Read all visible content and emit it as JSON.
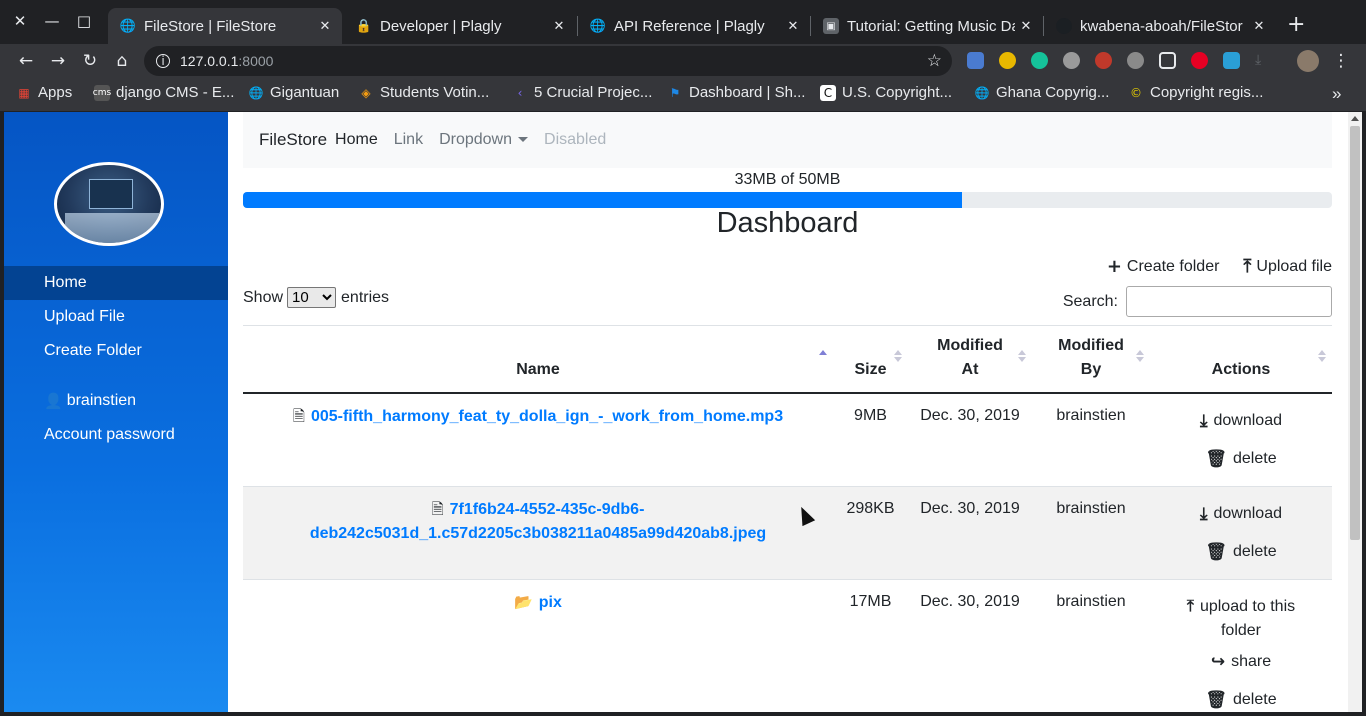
{
  "browser": {
    "window_controls": {
      "close": "✕",
      "minimize": "—",
      "maximize": "□"
    },
    "tabs": [
      {
        "title": "FileStore | FileStore",
        "icon": "globe-icon"
      },
      {
        "title": "Developer | Plagly",
        "icon": "lock-icon"
      },
      {
        "title": "API Reference | Plagly",
        "icon": "globe-icon"
      },
      {
        "title": "Tutorial: Getting Music Da",
        "icon": "tutorial-icon"
      },
      {
        "title": "kwabena-aboah/FileStor",
        "icon": "github-icon"
      }
    ],
    "new_tab": "+",
    "url": {
      "host": "127.0.0.1",
      "port": ":8000"
    },
    "bookmarks": [
      {
        "label": "Apps",
        "icon": "apps-grid-icon"
      },
      {
        "label": "django CMS - E...",
        "icon": "django-cms-icon"
      },
      {
        "label": "Gigantuan",
        "icon": "globe-icon"
      },
      {
        "label": "Students Votin...",
        "icon": "diamond-icon"
      },
      {
        "label": "5 Crucial Projec...",
        "icon": "chevron-left-icon"
      },
      {
        "label": "Dashboard | Sh...",
        "icon": "flag-icon"
      },
      {
        "label": "U.S. Copyright...",
        "icon": "copyright-c-icon"
      },
      {
        "label": "Ghana Copyrig...",
        "icon": "globe-icon"
      },
      {
        "label": "Copyright regis...",
        "icon": "copyright-icon"
      }
    ],
    "bookmarks_overflow": "»"
  },
  "sidebar": {
    "items": [
      {
        "label": "Home",
        "active": true
      },
      {
        "label": "Upload File"
      },
      {
        "label": "Create Folder"
      }
    ],
    "user": "brainstien",
    "account": "Account password"
  },
  "navbar": {
    "brand": "FileStore",
    "links": [
      "Home",
      "Link",
      "Dropdown",
      "Disabled"
    ]
  },
  "storage": {
    "text": "33MB of 50MB",
    "used_fraction": 0.66
  },
  "page_title": "Dashboard",
  "top_actions": {
    "create_folder": "Create folder",
    "upload_file": "Upload file"
  },
  "table_controls": {
    "show": "Show",
    "entries_value": "10",
    "entries": "entries",
    "search_label": "Search:"
  },
  "columns": [
    "Name",
    "Size",
    "Modified At",
    "Modified By",
    "Actions"
  ],
  "rows": [
    {
      "name": "005-fifth_harmony_feat_ty_dolla_ign_-_work_from_home.mp3",
      "size": "9MB",
      "modified_at": "Dec. 30, 2019",
      "modified_by": "brainstien",
      "actions": [
        "download",
        "delete"
      ],
      "type": "file"
    },
    {
      "name_line1": "7f1f6b24-4552-435c-9db6-",
      "name_line2": "deb242c5031d_1.c57d2205c3b038211a0485a99d420ab8.jpeg",
      "size": "298KB",
      "modified_at": "Dec. 30, 2019",
      "modified_by": "brainstien",
      "actions": [
        "download",
        "delete"
      ],
      "type": "file"
    },
    {
      "name": "pix",
      "size": "17MB",
      "modified_at": "Dec. 30, 2019",
      "modified_by": "brainstien",
      "actions_line1": "upload to this",
      "actions_line2": "folder",
      "actions": [
        "share",
        "delete"
      ],
      "type": "folder"
    }
  ],
  "colors": {
    "sidebar": "#0a6fe0",
    "link": "#007bff",
    "progress": "#007bff"
  }
}
